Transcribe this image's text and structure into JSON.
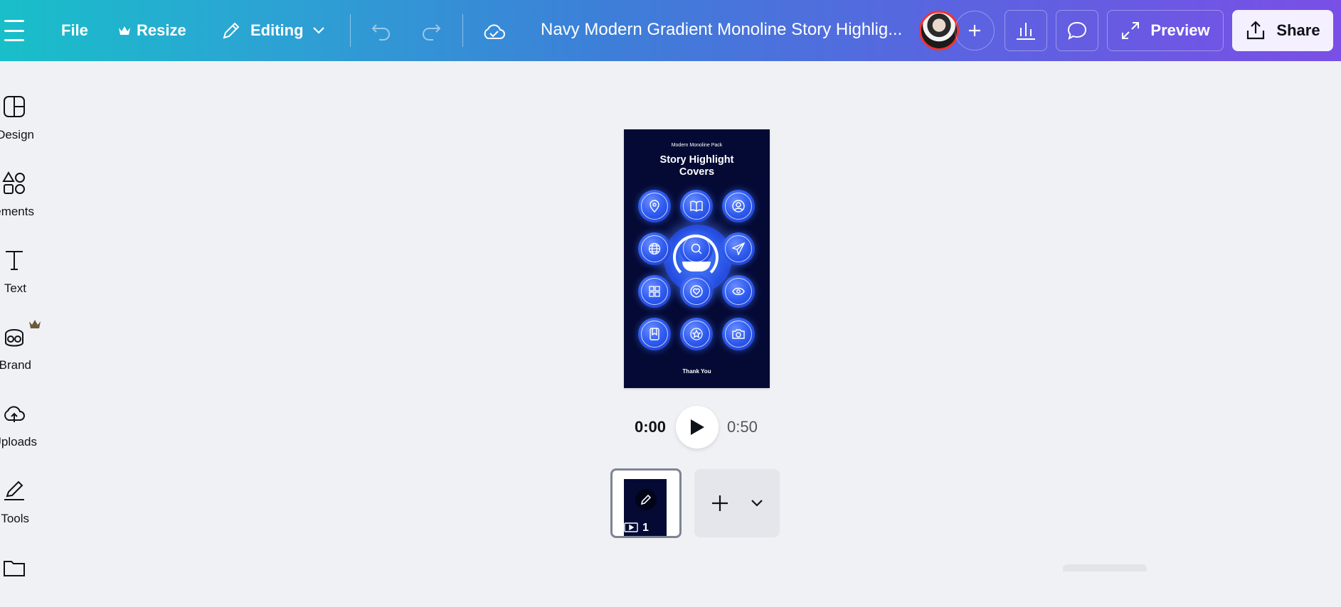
{
  "topbar": {
    "file_label": "File",
    "resize_label": "Resize",
    "editing_label": "Editing",
    "doc_title": "Navy Modern Gradient Monoline Story Highlig...",
    "preview_label": "Preview",
    "share_label": "Share"
  },
  "sidebar": {
    "items": [
      {
        "label": "Design",
        "icon": "design-icon"
      },
      {
        "label": "Elements",
        "icon": "elements-icon"
      },
      {
        "label": "Text",
        "icon": "text-icon"
      },
      {
        "label": "Brand",
        "icon": "brand-icon"
      },
      {
        "label": "Uploads",
        "icon": "uploads-icon"
      },
      {
        "label": "Tools",
        "icon": "tools-icon"
      },
      {
        "label": "",
        "icon": "projects-icon"
      }
    ]
  },
  "design": {
    "subtitle": "Modern Monoline Pack",
    "title_line1": "Story Highlight",
    "title_line2": "Covers",
    "footer": "Thank You",
    "icons": [
      "location-icon",
      "book-icon",
      "user-icon",
      "globe-icon",
      "search-icon",
      "send-icon",
      "grid-icon",
      "heart-icon",
      "eye-icon",
      "bookmark-icon",
      "star-icon",
      "camera-icon"
    ]
  },
  "playback": {
    "current_time": "0:00",
    "total_time": "0:50"
  },
  "pages": {
    "thumb_number": "1"
  },
  "colors": {
    "accent_gradient_start": "#18bfc9",
    "accent_gradient_end": "#7a4fe6",
    "design_bg": "#050a35",
    "circle_blue": "#2f5cf0"
  }
}
